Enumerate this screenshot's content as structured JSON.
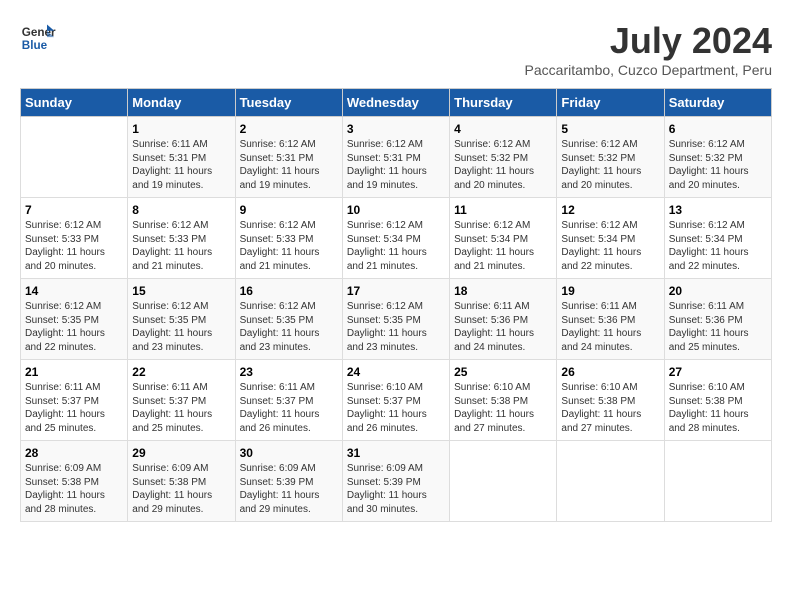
{
  "header": {
    "logo_line1": "General",
    "logo_line2": "Blue",
    "main_title": "July 2024",
    "subtitle": "Paccaritambo, Cuzco Department, Peru"
  },
  "columns": [
    "Sunday",
    "Monday",
    "Tuesday",
    "Wednesday",
    "Thursday",
    "Friday",
    "Saturday"
  ],
  "weeks": [
    [
      {
        "day": "",
        "sunrise": "",
        "sunset": "",
        "daylight": ""
      },
      {
        "day": "1",
        "sunrise": "6:11 AM",
        "sunset": "5:31 PM",
        "daylight": "11 hours and 19 minutes."
      },
      {
        "day": "2",
        "sunrise": "6:12 AM",
        "sunset": "5:31 PM",
        "daylight": "11 hours and 19 minutes."
      },
      {
        "day": "3",
        "sunrise": "6:12 AM",
        "sunset": "5:31 PM",
        "daylight": "11 hours and 19 minutes."
      },
      {
        "day": "4",
        "sunrise": "6:12 AM",
        "sunset": "5:32 PM",
        "daylight": "11 hours and 20 minutes."
      },
      {
        "day": "5",
        "sunrise": "6:12 AM",
        "sunset": "5:32 PM",
        "daylight": "11 hours and 20 minutes."
      },
      {
        "day": "6",
        "sunrise": "6:12 AM",
        "sunset": "5:32 PM",
        "daylight": "11 hours and 20 minutes."
      }
    ],
    [
      {
        "day": "7",
        "sunrise": "6:12 AM",
        "sunset": "5:33 PM",
        "daylight": "11 hours and 20 minutes."
      },
      {
        "day": "8",
        "sunrise": "6:12 AM",
        "sunset": "5:33 PM",
        "daylight": "11 hours and 21 minutes."
      },
      {
        "day": "9",
        "sunrise": "6:12 AM",
        "sunset": "5:33 PM",
        "daylight": "11 hours and 21 minutes."
      },
      {
        "day": "10",
        "sunrise": "6:12 AM",
        "sunset": "5:34 PM",
        "daylight": "11 hours and 21 minutes."
      },
      {
        "day": "11",
        "sunrise": "6:12 AM",
        "sunset": "5:34 PM",
        "daylight": "11 hours and 21 minutes."
      },
      {
        "day": "12",
        "sunrise": "6:12 AM",
        "sunset": "5:34 PM",
        "daylight": "11 hours and 22 minutes."
      },
      {
        "day": "13",
        "sunrise": "6:12 AM",
        "sunset": "5:34 PM",
        "daylight": "11 hours and 22 minutes."
      }
    ],
    [
      {
        "day": "14",
        "sunrise": "6:12 AM",
        "sunset": "5:35 PM",
        "daylight": "11 hours and 22 minutes."
      },
      {
        "day": "15",
        "sunrise": "6:12 AM",
        "sunset": "5:35 PM",
        "daylight": "11 hours and 23 minutes."
      },
      {
        "day": "16",
        "sunrise": "6:12 AM",
        "sunset": "5:35 PM",
        "daylight": "11 hours and 23 minutes."
      },
      {
        "day": "17",
        "sunrise": "6:12 AM",
        "sunset": "5:35 PM",
        "daylight": "11 hours and 23 minutes."
      },
      {
        "day": "18",
        "sunrise": "6:11 AM",
        "sunset": "5:36 PM",
        "daylight": "11 hours and 24 minutes."
      },
      {
        "day": "19",
        "sunrise": "6:11 AM",
        "sunset": "5:36 PM",
        "daylight": "11 hours and 24 minutes."
      },
      {
        "day": "20",
        "sunrise": "6:11 AM",
        "sunset": "5:36 PM",
        "daylight": "11 hours and 25 minutes."
      }
    ],
    [
      {
        "day": "21",
        "sunrise": "6:11 AM",
        "sunset": "5:37 PM",
        "daylight": "11 hours and 25 minutes."
      },
      {
        "day": "22",
        "sunrise": "6:11 AM",
        "sunset": "5:37 PM",
        "daylight": "11 hours and 25 minutes."
      },
      {
        "day": "23",
        "sunrise": "6:11 AM",
        "sunset": "5:37 PM",
        "daylight": "11 hours and 26 minutes."
      },
      {
        "day": "24",
        "sunrise": "6:10 AM",
        "sunset": "5:37 PM",
        "daylight": "11 hours and 26 minutes."
      },
      {
        "day": "25",
        "sunrise": "6:10 AM",
        "sunset": "5:38 PM",
        "daylight": "11 hours and 27 minutes."
      },
      {
        "day": "26",
        "sunrise": "6:10 AM",
        "sunset": "5:38 PM",
        "daylight": "11 hours and 27 minutes."
      },
      {
        "day": "27",
        "sunrise": "6:10 AM",
        "sunset": "5:38 PM",
        "daylight": "11 hours and 28 minutes."
      }
    ],
    [
      {
        "day": "28",
        "sunrise": "6:09 AM",
        "sunset": "5:38 PM",
        "daylight": "11 hours and 28 minutes."
      },
      {
        "day": "29",
        "sunrise": "6:09 AM",
        "sunset": "5:38 PM",
        "daylight": "11 hours and 29 minutes."
      },
      {
        "day": "30",
        "sunrise": "6:09 AM",
        "sunset": "5:39 PM",
        "daylight": "11 hours and 29 minutes."
      },
      {
        "day": "31",
        "sunrise": "6:09 AM",
        "sunset": "5:39 PM",
        "daylight": "11 hours and 30 minutes."
      },
      {
        "day": "",
        "sunrise": "",
        "sunset": "",
        "daylight": ""
      },
      {
        "day": "",
        "sunrise": "",
        "sunset": "",
        "daylight": ""
      },
      {
        "day": "",
        "sunrise": "",
        "sunset": "",
        "daylight": ""
      }
    ]
  ]
}
